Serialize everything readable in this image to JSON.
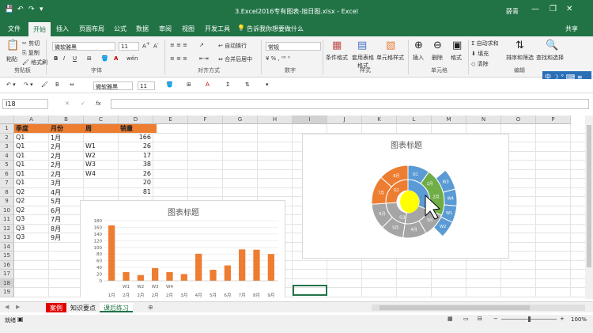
{
  "window": {
    "title": "3.Excel2016专有图表-旭日图.xlsx - Excel",
    "user": "薛青",
    "minimize": "—",
    "restore": "❐",
    "close": "✕"
  },
  "qat": {
    "save": "💾",
    "undo": "↶",
    "redo": "↷",
    "more": "▾"
  },
  "tabs": [
    "文件",
    "开始",
    "插入",
    "页面布局",
    "公式",
    "数据",
    "审阅",
    "视图",
    "开发工具"
  ],
  "tell_me": "告诉我你想要做什么",
  "share": "共享",
  "ribbon": {
    "paste": "粘贴",
    "cut": "剪切",
    "copy": "复制",
    "format_painter": "格式刷",
    "clipboard": "剪贴板",
    "font_name": "微软雅黑",
    "font_size": "11",
    "font_group": "字体",
    "wrap": "自动换行",
    "merge": "合并后居中",
    "align_group": "对齐方式",
    "number_format": "常规",
    "number_group": "数字",
    "cond_format": "条件格式",
    "table_format": "套用表格格式",
    "cell_style": "单元格样式",
    "style_group": "样式",
    "insert": "插入",
    "delete": "删除",
    "format": "格式",
    "cells_group": "单元格",
    "autosum": "自动求和",
    "fill": "填充",
    "clear": "清除",
    "sort": "排序和筛选",
    "find": "查找和选择",
    "edit_group": "编辑"
  },
  "ime": "中 ☽ ° ⌨ ≡ ⁂",
  "toolbar2": {
    "font_name": "微软雅黑",
    "font_size": "11"
  },
  "formula_bar": {
    "name_box": "I18",
    "fx": "fx",
    "cancel": "✕",
    "enter": "✓",
    "value": ""
  },
  "columns": [
    "A",
    "B",
    "C",
    "D",
    "E",
    "F",
    "G",
    "H",
    "I",
    "J",
    "K",
    "L",
    "M",
    "N",
    "O",
    "P"
  ],
  "rows": [
    "1",
    "2",
    "3",
    "4",
    "5",
    "6",
    "7",
    "8",
    "9",
    "10",
    "11",
    "12",
    "13",
    "14",
    "15",
    "16",
    "17",
    "18",
    "19"
  ],
  "sheet": {
    "headers": [
      "季度",
      "月份",
      "周",
      "销量"
    ],
    "rows": [
      [
        "Q1",
        "1月",
        "",
        "166"
      ],
      [
        "Q1",
        "2月",
        "W1",
        "26"
      ],
      [
        "Q1",
        "2月",
        "W2",
        "17"
      ],
      [
        "Q1",
        "2月",
        "W3",
        "38"
      ],
      [
        "Q1",
        "2月",
        "W4",
        "26"
      ],
      [
        "Q1",
        "3月",
        "",
        "20"
      ],
      [
        "Q2",
        "4月",
        "",
        "81"
      ],
      [
        "Q2",
        "5月",
        "",
        ""
      ],
      [
        "Q2",
        "6月",
        "",
        ""
      ],
      [
        "Q3",
        "7月",
        "",
        ""
      ],
      [
        "Q3",
        "8月",
        "",
        ""
      ],
      [
        "Q3",
        "9月",
        "",
        ""
      ]
    ]
  },
  "bar_chart": {
    "title": "图表标题",
    "chart_data": {
      "type": "bar",
      "title": "图表标题",
      "categories": [
        "1月",
        "W1",
        "W2",
        "W3",
        "W4",
        "3月",
        "4月",
        "5月",
        "6月",
        "7月",
        "8月",
        "9月"
      ],
      "group_labels": [
        "1月",
        "2月",
        "2月",
        "2月",
        "2月",
        "3月",
        "4月",
        "5月",
        "6月",
        "7月",
        "8月",
        "9月"
      ],
      "values": [
        166,
        26,
        17,
        38,
        26,
        20,
        81,
        33,
        46,
        94,
        93,
        80
      ],
      "yticks": [
        0,
        20,
        40,
        60,
        80,
        100,
        120,
        140,
        160,
        180
      ],
      "ylim": [
        0,
        180
      ],
      "color": "#ed7d31",
      "grid": true
    }
  },
  "sunburst_chart": {
    "title": "图表标题",
    "chart_data": {
      "type": "sunburst",
      "title": "图表标题",
      "visible_labels": [
        "Q1",
        "W3",
        "W4",
        "W1",
        "W2",
        "1月",
        "2月",
        "3月",
        "4月",
        "5月",
        "6月",
        "7月",
        "8月",
        "9月",
        "Q2",
        "Q3"
      ]
    }
  },
  "sheet_tabs": [
    "案例",
    "知识要点",
    "课后练习"
  ],
  "add_sheet": "⊕",
  "status": {
    "ready": "就绪",
    "zoom": "100%"
  }
}
